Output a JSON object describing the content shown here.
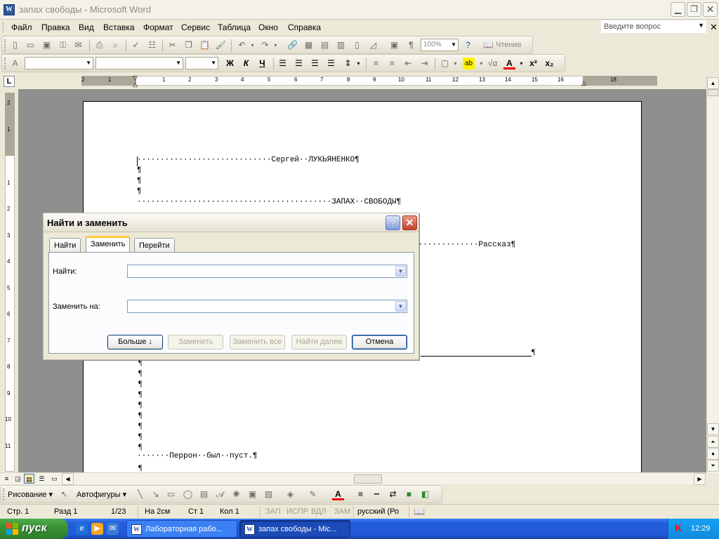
{
  "window": {
    "title": "запах свободы - Microsoft Word",
    "app_icon": "W"
  },
  "menu": {
    "items": [
      "Файл",
      "Правка",
      "Вид",
      "Вставка",
      "Формат",
      "Сервис",
      "Таблица",
      "Окно",
      "Справка"
    ],
    "ask_placeholder": "Введите вопрос"
  },
  "standard_toolbar": {
    "zoom": "100%",
    "read_label": "Чтение"
  },
  "format_toolbar": {
    "style": "",
    "font": "",
    "size": "",
    "bold": "Ж",
    "italic": "К",
    "underline": "Ч"
  },
  "ruler": {
    "h_ticks": [
      "2",
      "1",
      "1",
      "2",
      "3",
      "4",
      "5",
      "6",
      "7",
      "8",
      "9",
      "10",
      "11",
      "12",
      "13",
      "14",
      "15",
      "16",
      "18"
    ],
    "v_ticks": [
      "2",
      "1",
      "1",
      "2",
      "3",
      "4",
      "5",
      "6",
      "7",
      "8",
      "9",
      "10",
      "11"
    ]
  },
  "document": {
    "lines": [
      {
        "text": "·····························Сергей··ЛУКЬЯНЕНКО¶"
      },
      {
        "text": "¶"
      },
      {
        "text": "¶"
      },
      {
        "text": "¶"
      },
      {
        "text": "··········································ЗАПАХ··СВОБОДЫ¶"
      },
      {
        "text": "··············Рассказ¶"
      },
      {
        "text": "·······Перрон··был··пуст.¶"
      }
    ]
  },
  "dialog": {
    "title": "Найти и заменить",
    "tabs": [
      "Найти",
      "Заменить",
      "Перейти"
    ],
    "active_tab": "Заменить",
    "find_label": "Найти:",
    "find_value": "",
    "replace_label": "Заменить на:",
    "replace_value": "",
    "buttons": {
      "more": "Больше ↓",
      "replace": "Заменить",
      "replace_all": "Заменить все",
      "find_next": "Найти далее",
      "cancel": "Отмена"
    }
  },
  "drawing_toolbar": {
    "draw_label": "Рисование ▾",
    "autoshapes_label": "Автофигуры ▾"
  },
  "status": {
    "page": "Стр. 1",
    "section": "Разд 1",
    "pages": "1/23",
    "at": "На 2см",
    "line": "Ст 1",
    "col": "Кол 1",
    "rec": "ЗАП",
    "trk": "ИСПР",
    "ext": "ВДЛ",
    "ovr": "ЗАМ",
    "lang": "русский (Ро"
  },
  "taskbar": {
    "start": "пуск",
    "tasks": [
      "Лабораторная рабо...",
      "запах свободы - Mic..."
    ],
    "clock": "12:29"
  },
  "colors": {
    "taskbar": "#245DDB",
    "start": "#3A9236",
    "dialog_tab_accent": "#FFC83C"
  }
}
